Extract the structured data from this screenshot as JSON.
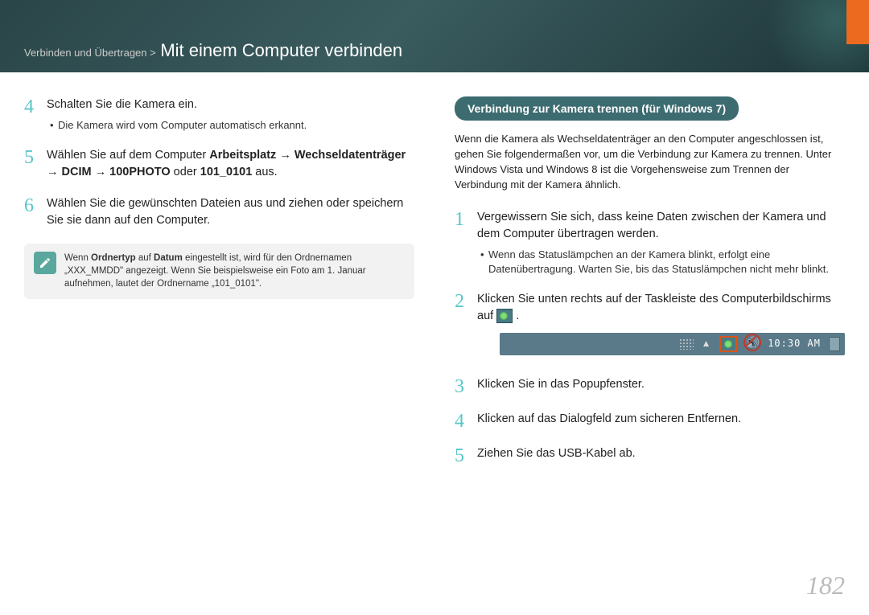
{
  "header": {
    "breadcrumb": "Verbinden und Übertragen > ",
    "title": "Mit einem Computer verbinden"
  },
  "left": {
    "step4": {
      "num": "4",
      "text": "Schalten Sie die Kamera ein.",
      "bullet": "Die Kamera wird vom Computer automatisch erkannt."
    },
    "step5": {
      "num": "5",
      "text_a": "Wählen Sie auf dem Computer ",
      "bold_a": "Arbeitsplatz",
      "arrow": " → ",
      "bold_b": "Wechseldatenträger",
      "bold_c": "DCIM",
      "bold_d": "100PHOTO",
      "text_b": " oder ",
      "bold_e": "101_0101",
      "text_c": " aus."
    },
    "step6": {
      "num": "6",
      "text": "Wählen Sie die gewünschten Dateien aus und ziehen oder speichern Sie sie dann auf den Computer."
    },
    "note": {
      "text_a": "Wenn ",
      "bold_a": "Ordnertyp",
      "text_b": " auf ",
      "bold_b": "Datum",
      "text_c": " eingestellt ist, wird für den Ordnernamen „XXX_MMDD\" angezeigt. Wenn Sie beispielsweise ein Foto am 1. Januar aufnehmen, lautet der Ordnername „101_0101\"."
    }
  },
  "right": {
    "pill": "Verbindung zur Kamera trennen (für Windows 7)",
    "intro": "Wenn die Kamera als Wechseldatenträger an den Computer angeschlossen ist, gehen Sie folgendermaßen vor, um die Verbindung zur Kamera zu trennen. Unter Windows Vista und Windows 8 ist die Vorgehensweise zum Trennen der Verbindung mit der Kamera ähnlich.",
    "step1": {
      "num": "1",
      "text": "Vergewissern Sie sich, dass keine Daten zwischen der Kamera und dem Computer übertragen werden.",
      "bullet": "Wenn das Statuslämpchen an der Kamera blinkt, erfolgt eine Datenübertragung. Warten Sie, bis das Statuslämpchen nicht mehr blinkt."
    },
    "step2": {
      "num": "2",
      "text_a": "Klicken Sie unten rechts auf der Taskleiste des Computerbildschirms auf ",
      "text_b": "."
    },
    "taskbar_time": "10:30 AM",
    "step3": {
      "num": "3",
      "text": "Klicken Sie in das Popupfenster."
    },
    "step4": {
      "num": "4",
      "text": "Klicken auf das Dialogfeld zum sicheren Entfernen."
    },
    "step5": {
      "num": "5",
      "text": "Ziehen Sie das USB-Kabel ab."
    }
  },
  "page_number": "182"
}
